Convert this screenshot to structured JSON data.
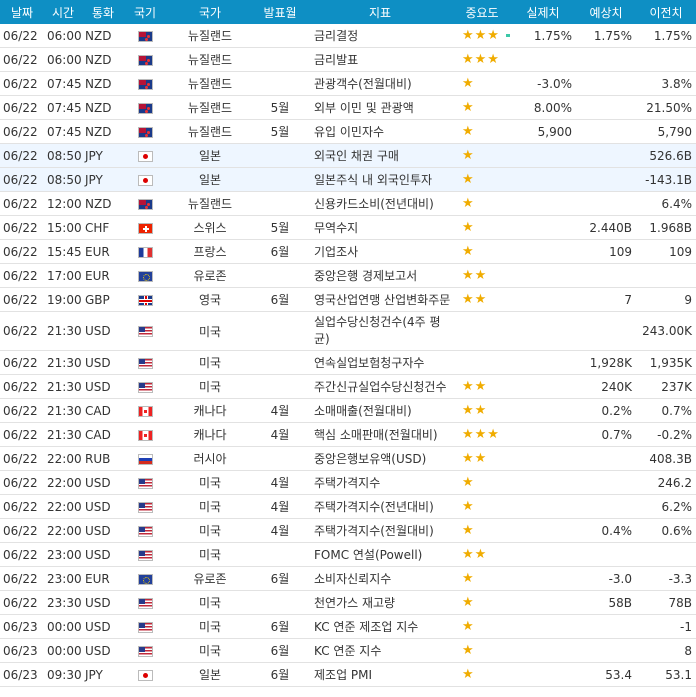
{
  "headers": {
    "date": "날짜",
    "time": "시간",
    "currency": "통화",
    "flag": "국기",
    "country": "국가",
    "month": "발표월",
    "indicator": "지표",
    "importance": "중요도",
    "actual": "실제치",
    "forecast": "예상치",
    "previous": "이전치"
  },
  "rows": [
    {
      "date": "06/22",
      "time": "06:00",
      "currency": "NZD",
      "flag": "nzd",
      "flag_icon": "new-zealand-flag-icon",
      "country": "뉴질랜드",
      "month": "",
      "indicator": "금리결정",
      "stars": "★★★",
      "dash": true,
      "actual": "1.75%",
      "forecast": "1.75%",
      "previous": "1.75%",
      "tall": false,
      "hl": false
    },
    {
      "date": "06/22",
      "time": "06:00",
      "currency": "NZD",
      "flag": "nzd",
      "flag_icon": "new-zealand-flag-icon",
      "country": "뉴질랜드",
      "month": "",
      "indicator": "금리발표",
      "stars": "★★★",
      "dash": false,
      "actual": "",
      "forecast": "",
      "previous": "",
      "tall": false,
      "hl": false
    },
    {
      "date": "06/22",
      "time": "07:45",
      "currency": "NZD",
      "flag": "nzd",
      "flag_icon": "new-zealand-flag-icon",
      "country": "뉴질랜드",
      "month": "",
      "indicator": "관광객수(전월대비)",
      "stars": "★",
      "dash": false,
      "actual": "-3.0%",
      "forecast": "",
      "previous": "3.8%",
      "tall": false,
      "hl": false
    },
    {
      "date": "06/22",
      "time": "07:45",
      "currency": "NZD",
      "flag": "nzd",
      "flag_icon": "new-zealand-flag-icon",
      "country": "뉴질랜드",
      "month": "5월",
      "indicator": "외부 이민 및 관광액",
      "stars": "★",
      "dash": false,
      "actual": "8.00%",
      "forecast": "",
      "previous": "21.50%",
      "tall": false,
      "hl": false
    },
    {
      "date": "06/22",
      "time": "07:45",
      "currency": "NZD",
      "flag": "nzd",
      "flag_icon": "new-zealand-flag-icon",
      "country": "뉴질랜드",
      "month": "5월",
      "indicator": "유입 이민자수",
      "stars": "★",
      "dash": false,
      "actual": "5,900",
      "forecast": "",
      "previous": "5,790",
      "tall": false,
      "hl": false
    },
    {
      "date": "06/22",
      "time": "08:50",
      "currency": "JPY",
      "flag": "jpy",
      "flag_icon": "japan-flag-icon",
      "country": "일본",
      "month": "",
      "indicator": "외국인 채권 구매",
      "stars": "★",
      "dash": false,
      "actual": "",
      "forecast": "",
      "previous": "526.6B",
      "tall": false,
      "hl": true
    },
    {
      "date": "06/22",
      "time": "08:50",
      "currency": "JPY",
      "flag": "jpy",
      "flag_icon": "japan-flag-icon",
      "country": "일본",
      "month": "",
      "indicator": "일본주식 내 외국인투자",
      "stars": "★",
      "dash": false,
      "actual": "",
      "forecast": "",
      "previous": "-143.1B",
      "tall": false,
      "hl": true
    },
    {
      "date": "06/22",
      "time": "12:00",
      "currency": "NZD",
      "flag": "nzd",
      "flag_icon": "new-zealand-flag-icon",
      "country": "뉴질랜드",
      "month": "",
      "indicator": "신용카드소비(전년대비)",
      "stars": "★",
      "dash": false,
      "actual": "",
      "forecast": "",
      "previous": "6.4%",
      "tall": false,
      "hl": false
    },
    {
      "date": "06/22",
      "time": "15:00",
      "currency": "CHF",
      "flag": "chf",
      "flag_icon": "switzerland-flag-icon",
      "country": "스위스",
      "month": "5월",
      "indicator": "무역수지",
      "stars": "★",
      "dash": false,
      "actual": "",
      "forecast": "2.440B",
      "previous": "1.968B",
      "tall": false,
      "hl": false
    },
    {
      "date": "06/22",
      "time": "15:45",
      "currency": "EUR",
      "flag": "eur-fr",
      "flag_icon": "france-flag-icon",
      "country": "프랑스",
      "month": "6월",
      "indicator": "기업조사",
      "stars": "★",
      "dash": false,
      "actual": "",
      "forecast": "109",
      "previous": "109",
      "tall": false,
      "hl": false
    },
    {
      "date": "06/22",
      "time": "17:00",
      "currency": "EUR",
      "flag": "eu",
      "flag_icon": "eu-flag-icon",
      "country": "유로존",
      "month": "",
      "indicator": "중앙은행 경제보고서",
      "stars": "★★",
      "dash": false,
      "actual": "",
      "forecast": "",
      "previous": "",
      "tall": false,
      "hl": false
    },
    {
      "date": "06/22",
      "time": "19:00",
      "currency": "GBP",
      "flag": "gbp",
      "flag_icon": "uk-flag-icon",
      "country": "영국",
      "month": "6월",
      "indicator": "영국산업연맹 산업변화주문",
      "stars": "★★",
      "dash": false,
      "actual": "",
      "forecast": "7",
      "previous": "9",
      "tall": false,
      "hl": false
    },
    {
      "date": "06/22",
      "time": "21:30",
      "currency": "USD",
      "flag": "usd",
      "flag_icon": "usa-flag-icon",
      "country": "미국",
      "month": "",
      "indicator": "실업수당신청건수(4주 평균)",
      "stars": "",
      "dash": false,
      "actual": "",
      "forecast": "",
      "previous": "243.00K",
      "tall": true,
      "hl": false
    },
    {
      "date": "06/22",
      "time": "21:30",
      "currency": "USD",
      "flag": "usd",
      "flag_icon": "usa-flag-icon",
      "country": "미국",
      "month": "",
      "indicator": "연속실업보험청구자수",
      "stars": "",
      "dash": false,
      "actual": "",
      "forecast": "1,928K",
      "previous": "1,935K",
      "tall": false,
      "hl": false
    },
    {
      "date": "06/22",
      "time": "21:30",
      "currency": "USD",
      "flag": "usd",
      "flag_icon": "usa-flag-icon",
      "country": "미국",
      "month": "",
      "indicator": "주간신규실업수당신청건수",
      "stars": "★★",
      "dash": false,
      "actual": "",
      "forecast": "240K",
      "previous": "237K",
      "tall": false,
      "hl": false
    },
    {
      "date": "06/22",
      "time": "21:30",
      "currency": "CAD",
      "flag": "cad",
      "flag_icon": "canada-flag-icon",
      "country": "캐나다",
      "month": "4월",
      "indicator": "소매매출(전월대비)",
      "stars": "★★",
      "dash": false,
      "actual": "",
      "forecast": "0.2%",
      "previous": "0.7%",
      "tall": false,
      "hl": false
    },
    {
      "date": "06/22",
      "time": "21:30",
      "currency": "CAD",
      "flag": "cad",
      "flag_icon": "canada-flag-icon",
      "country": "캐나다",
      "month": "4월",
      "indicator": "핵심 소매판매(전월대비)",
      "stars": "★★★",
      "dash": false,
      "actual": "",
      "forecast": "0.7%",
      "previous": "-0.2%",
      "tall": false,
      "hl": false
    },
    {
      "date": "06/22",
      "time": "22:00",
      "currency": "RUB",
      "flag": "rub",
      "flag_icon": "russia-flag-icon",
      "country": "러시아",
      "month": "",
      "indicator": "중앙은행보유액(USD)",
      "stars": "★★",
      "dash": false,
      "actual": "",
      "forecast": "",
      "previous": "408.3B",
      "tall": false,
      "hl": false
    },
    {
      "date": "06/22",
      "time": "22:00",
      "currency": "USD",
      "flag": "usd",
      "flag_icon": "usa-flag-icon",
      "country": "미국",
      "month": "4월",
      "indicator": "주택가격지수",
      "stars": "★",
      "dash": false,
      "actual": "",
      "forecast": "",
      "previous": "246.2",
      "tall": false,
      "hl": false
    },
    {
      "date": "06/22",
      "time": "22:00",
      "currency": "USD",
      "flag": "usd",
      "flag_icon": "usa-flag-icon",
      "country": "미국",
      "month": "4월",
      "indicator": "주택가격지수(전년대비)",
      "stars": "★",
      "dash": false,
      "actual": "",
      "forecast": "",
      "previous": "6.2%",
      "tall": false,
      "hl": false
    },
    {
      "date": "06/22",
      "time": "22:00",
      "currency": "USD",
      "flag": "usd",
      "flag_icon": "usa-flag-icon",
      "country": "미국",
      "month": "4월",
      "indicator": "주택가격지수(전월대비)",
      "stars": "★",
      "dash": false,
      "actual": "",
      "forecast": "0.4%",
      "previous": "0.6%",
      "tall": false,
      "hl": false
    },
    {
      "date": "06/22",
      "time": "23:00",
      "currency": "USD",
      "flag": "usd",
      "flag_icon": "usa-flag-icon",
      "country": "미국",
      "month": "",
      "indicator": "FOMC 연설(Powell)",
      "stars": "★★",
      "dash": false,
      "actual": "",
      "forecast": "",
      "previous": "",
      "tall": false,
      "hl": false
    },
    {
      "date": "06/22",
      "time": "23:00",
      "currency": "EUR",
      "flag": "eu",
      "flag_icon": "eu-flag-icon",
      "country": "유로존",
      "month": "6월",
      "indicator": "소비자신뢰지수",
      "stars": "★",
      "dash": false,
      "actual": "",
      "forecast": "-3.0",
      "previous": "-3.3",
      "tall": false,
      "hl": false
    },
    {
      "date": "06/22",
      "time": "23:30",
      "currency": "USD",
      "flag": "usd",
      "flag_icon": "usa-flag-icon",
      "country": "미국",
      "month": "",
      "indicator": "천연가스 재고량",
      "stars": "★",
      "dash": false,
      "actual": "",
      "forecast": "58B",
      "previous": "78B",
      "tall": false,
      "hl": false
    },
    {
      "date": "06/23",
      "time": "00:00",
      "currency": "USD",
      "flag": "usd",
      "flag_icon": "usa-flag-icon",
      "country": "미국",
      "month": "6월",
      "indicator": "KC 연준 제조업 지수",
      "stars": "★",
      "dash": false,
      "actual": "",
      "forecast": "",
      "previous": "-1",
      "tall": false,
      "hl": false
    },
    {
      "date": "06/23",
      "time": "00:00",
      "currency": "USD",
      "flag": "usd",
      "flag_icon": "usa-flag-icon",
      "country": "미국",
      "month": "6월",
      "indicator": "KC 연준 지수",
      "stars": "★",
      "dash": false,
      "actual": "",
      "forecast": "",
      "previous": "8",
      "tall": false,
      "hl": false
    },
    {
      "date": "06/23",
      "time": "09:30",
      "currency": "JPY",
      "flag": "jpy",
      "flag_icon": "japan-flag-icon",
      "country": "일본",
      "month": "6월",
      "indicator": "제조업 PMI",
      "stars": "★",
      "dash": false,
      "actual": "",
      "forecast": "53.4",
      "previous": "53.1",
      "tall": false,
      "hl": false
    }
  ],
  "colors": {
    "header_bg": "#0e8fc4",
    "star": "#f0ac00",
    "dash": "#3cc8a8",
    "row_highlight": "#eef6ff"
  }
}
